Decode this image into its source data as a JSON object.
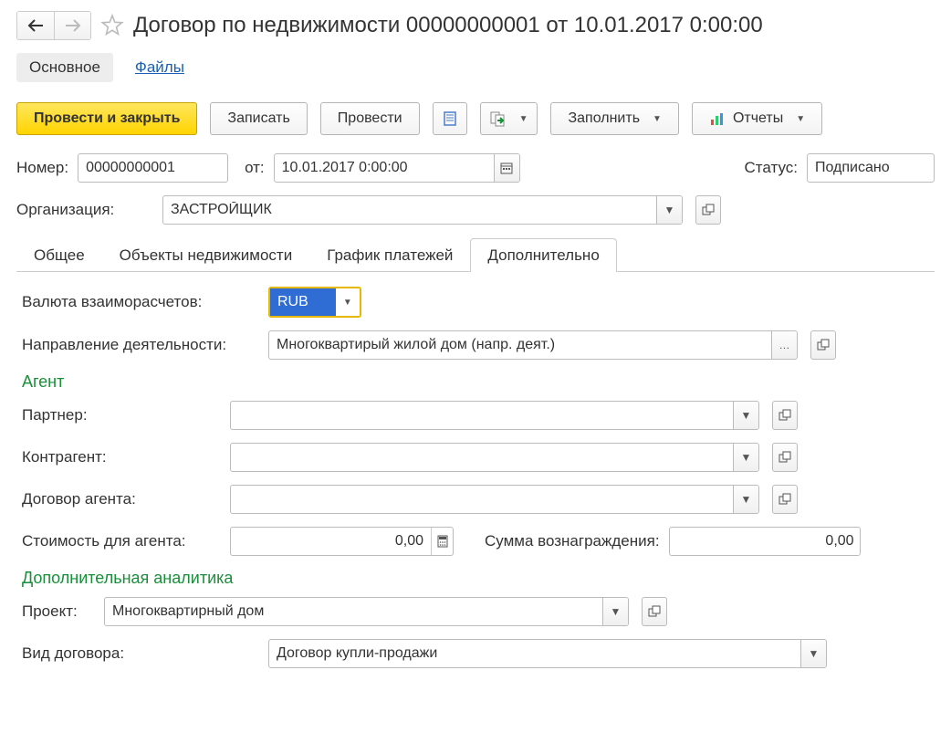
{
  "title": "Договор по недвижимости 00000000001 от 10.01.2017 0:00:00",
  "sectionTabs": {
    "main": "Основное",
    "files": "Файлы"
  },
  "toolbar": {
    "post_close": "Провести и закрыть",
    "save": "Записать",
    "post": "Провести",
    "fill": "Заполнить",
    "reports": "Отчеты"
  },
  "header": {
    "number_label": "Номер:",
    "number": "00000000001",
    "from_label": "от:",
    "date": "10.01.2017  0:00:00",
    "status_label": "Статус:",
    "status": "Подписано",
    "org_label": "Организация:",
    "org": "ЗАСТРОЙЩИК"
  },
  "tabs": [
    "Общее",
    "Объекты недвижимости",
    "График платежей",
    "Дополнительно"
  ],
  "activeTab": 3,
  "extra": {
    "currency_label": "Валюта взаиморасчетов:",
    "currency": "RUB",
    "direction_label": "Направление деятельности:",
    "direction": "Многоквартирый жилой дом (напр. деят.)",
    "agent_h": "Агент",
    "partner_label": "Партнер:",
    "partner": "",
    "counterparty_label": "Контрагент:",
    "counterparty": "",
    "agent_contract_label": "Договор агента:",
    "agent_contract": "",
    "agent_cost_label": "Стоимость для агента:",
    "agent_cost": "0,00",
    "reward_label": "Сумма вознаграждения:",
    "reward": "0,00",
    "analytics_h": "Дополнительная аналитика",
    "project_label": "Проект:",
    "project": "Многоквартирный дом",
    "contract_type_label": "Вид договора:",
    "contract_type": "Договор купли-продажи"
  }
}
